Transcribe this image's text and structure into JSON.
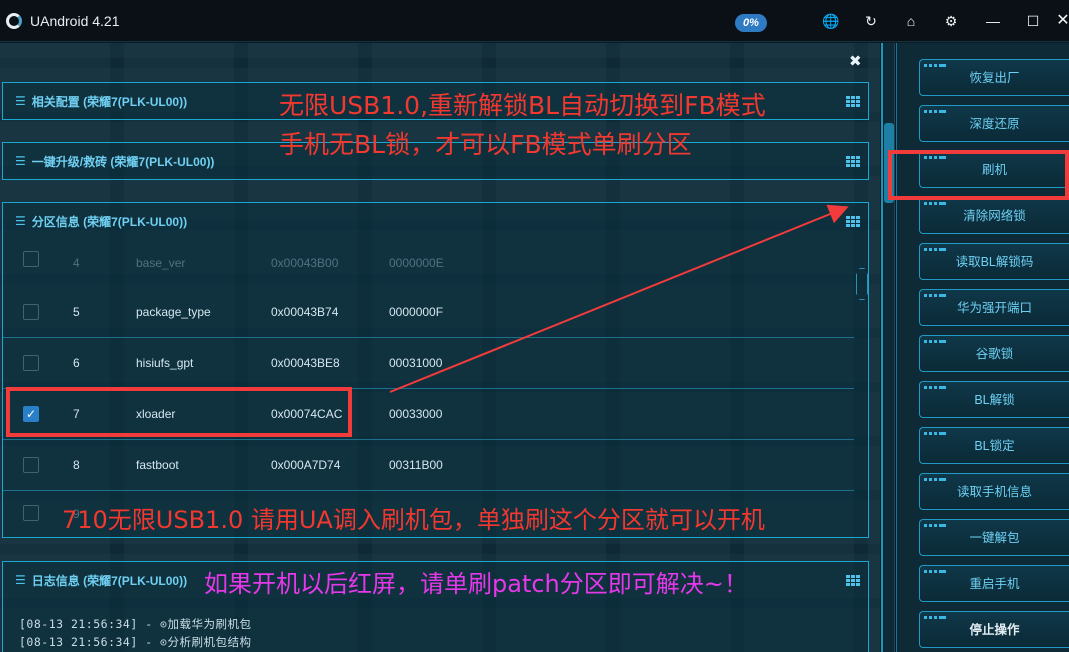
{
  "app": {
    "title": "UAndroid 4.21",
    "progress": "0%"
  },
  "titlebar_icons": [
    "globe-icon",
    "refresh-icon",
    "home-icon",
    "gear-icon",
    "minimize-icon",
    "maximize-icon",
    "close-icon"
  ],
  "panels": {
    "config": "相关配置 (荣耀7(PLK-UL00))",
    "upgrade": "一键升级/救砖 (荣耀7(PLK-UL00))",
    "partition": "分区信息 (荣耀7(PLK-UL00))",
    "log": "日志信息 (荣耀7(PLK-UL00))"
  },
  "partitions": [
    {
      "num": "4",
      "name": "base_ver",
      "addr": "0x00043B00",
      "size": "0000000E",
      "checked": false
    },
    {
      "num": "5",
      "name": "package_type",
      "addr": "0x00043B74",
      "size": "0000000F",
      "checked": false
    },
    {
      "num": "6",
      "name": "hisiufs_gpt",
      "addr": "0x00043BE8",
      "size": "00031000",
      "checked": false
    },
    {
      "num": "7",
      "name": "xloader",
      "addr": "0x00074CAC",
      "size": "00033000",
      "checked": true
    },
    {
      "num": "8",
      "name": "fastboot",
      "addr": "0x000A7D74",
      "size": "00311B00",
      "checked": false
    },
    {
      "num": "9",
      "name": "",
      "addr": "",
      "size": "",
      "checked": false
    }
  ],
  "log": [
    "[08-13 21:56:34] - ⊙加载华为刷机包",
    "[08-13 21:56:34] - ⊙分析刷机包结构"
  ],
  "sidebar": [
    "恢复出厂",
    "深度还原",
    "刷机",
    "清除网络锁",
    "读取BL解锁码",
    "华为强开端口",
    "谷歌锁",
    "BL解锁",
    "BL锁定",
    "读取手机信息",
    "一键解包",
    "重启手机",
    "停止操作"
  ],
  "annotations": {
    "line1": "无限USB1.0,重新解锁BL自动切换到FB模式",
    "line2": "手机无BL锁，才可以FB模式单刷分区",
    "line3": "710无限USB1.0 请用UA调入刷机包，单独刷这个分区就可以开机",
    "line4": "如果开机以后红屏，请单刷patch分区即可解决~！"
  },
  "colors": {
    "accent": "#1aa7d0",
    "annotation_red": "#f2382f",
    "annotation_magenta": "#e538ea",
    "progress_badge": "#2e7bc4"
  }
}
